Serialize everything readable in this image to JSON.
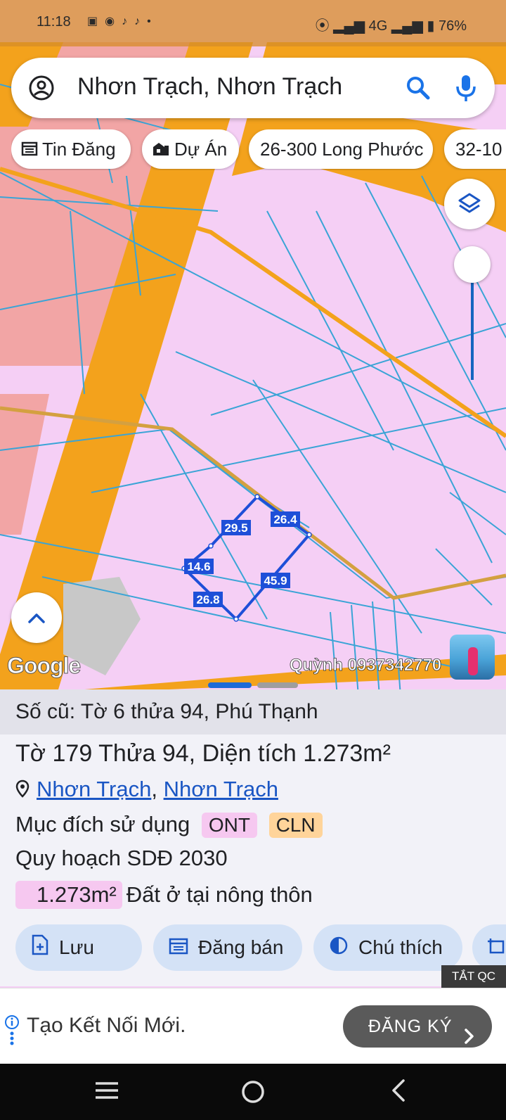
{
  "status_bar": {
    "time": "11:18",
    "app_icons": [
      "zalo-icon",
      "messenger-icon",
      "tiktok-icon",
      "tiktok-icon",
      "dot-icon"
    ],
    "right_text": "4G",
    "battery": "76%"
  },
  "search": {
    "query": "Nhơn Trạch, Nhơn Trạch"
  },
  "chips": [
    {
      "label": "Tin Đăng",
      "icon": "calendar-icon"
    },
    {
      "label": "Dự Án",
      "icon": "building-icon"
    },
    {
      "label": "26-300 Long Phước",
      "icon": ""
    },
    {
      "label": "32-10",
      "icon": ""
    }
  ],
  "map": {
    "edge_labels": [
      "29.5",
      "26.4",
      "14.6",
      "45.9",
      "26.8"
    ],
    "google_logo": "Google",
    "watermark": "Quỳnh 0937342770",
    "colors": {
      "residential": "#f5cff5",
      "road": "#f3a21c",
      "commercial": "#f2a5a5",
      "parcel_line": "#3aa4d6",
      "selected": "#1e4fd8"
    }
  },
  "sheet": {
    "old_number": "Số cũ: Tờ 6 thửa 94, Phú Thạnh",
    "parcel_title": "Tờ 179 Thửa 94, Diện tích 1.273m²",
    "location_part1": "Nhơn Trạch",
    "location_sep": ",",
    "location_part2": "Nhơn Trạch",
    "purpose_label": "Mục đích sử dụng",
    "tags": [
      "ONT",
      "CLN"
    ],
    "plan_label": "Quy hoạch SDĐ 2030",
    "area_value": "1.273m²",
    "area_desc": "Đất ở tại nông thôn"
  },
  "actions": [
    {
      "label": "Lưu",
      "icon": "save-file-icon"
    },
    {
      "label": "Đăng bán",
      "icon": "calendar-icon"
    },
    {
      "label": "Chú thích",
      "icon": "contrast-icon"
    }
  ],
  "ad": {
    "hide_label": "TẮT QC",
    "text": "Tạo Kết Nối Mới.",
    "cta": "ĐĂNG KÝ"
  }
}
